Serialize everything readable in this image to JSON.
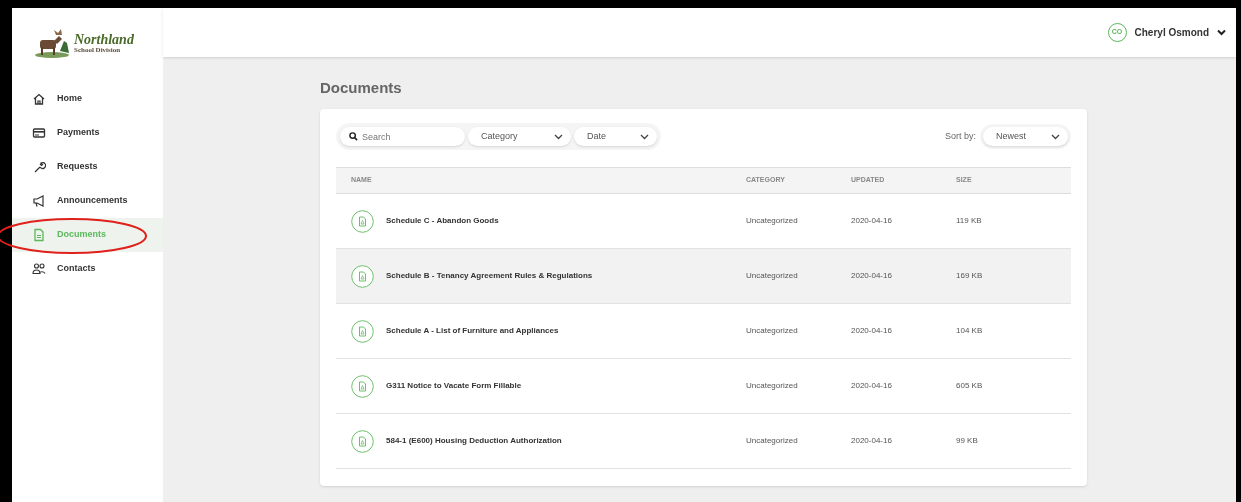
{
  "logo": {
    "title": "Northland",
    "subtitle": "School Division"
  },
  "sidebar": {
    "items": [
      {
        "label": "Home",
        "selected": false,
        "circled": false
      },
      {
        "label": "Payments",
        "selected": false,
        "circled": false
      },
      {
        "label": "Requests",
        "selected": false,
        "circled": false
      },
      {
        "label": "Announcements",
        "selected": false,
        "circled": false
      },
      {
        "label": "Documents",
        "selected": true,
        "circled": true
      },
      {
        "label": "Contacts",
        "selected": false,
        "circled": false
      }
    ]
  },
  "user": {
    "initials": "CO",
    "name": "Cheryl Osmond"
  },
  "page_title": "Documents",
  "filters": {
    "search": {
      "placeholder": "Search"
    },
    "category": "Category",
    "date": "Date",
    "sort_label": "Sort by:",
    "sort": "Newest"
  },
  "table": {
    "columns": [
      "NAME",
      "CATEGORY",
      "UPDATED",
      "SIZE"
    ],
    "rows": [
      {
        "name": "Schedule C - Abandon Goods",
        "category": "Uncategorized",
        "updated": "2020-04-16",
        "size": "119 KB",
        "highlighted": false
      },
      {
        "name": "Schedule B - Tenancy Agreement Rules & Regulations",
        "category": "Uncategorized",
        "updated": "2020-04-16",
        "size": "169 KB",
        "highlighted": true
      },
      {
        "name": "Schedule A - List of Furniture and Appliances",
        "category": "Uncategorized",
        "updated": "2020-04-16",
        "size": "104 KB",
        "highlighted": false
      },
      {
        "name": "G311 Notice to Vacate Form Fillable",
        "category": "Uncategorized",
        "updated": "2020-04-16",
        "size": "605 KB",
        "highlighted": false
      },
      {
        "name": "584-1 (E600) Housing Deduction Authorization",
        "category": "Uncategorized",
        "updated": "2020-04-16",
        "size": "99 KB",
        "highlighted": false
      }
    ]
  }
}
